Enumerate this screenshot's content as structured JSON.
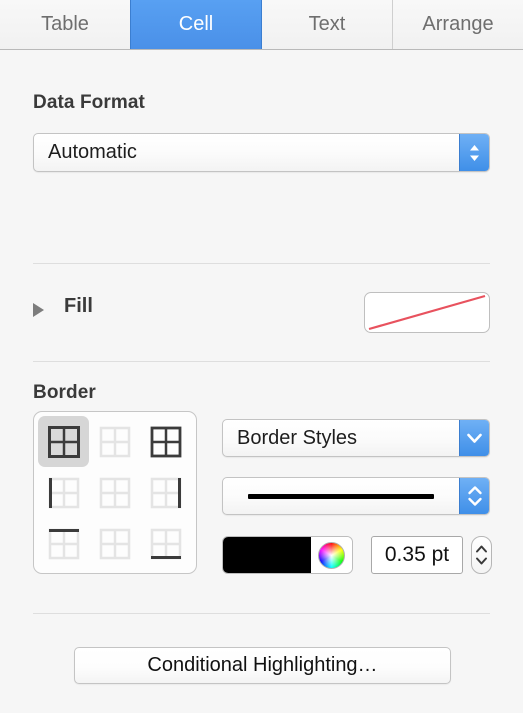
{
  "tabs": [
    {
      "label": "Table",
      "selected": false
    },
    {
      "label": "Cell",
      "selected": true
    },
    {
      "label": "Text",
      "selected": false
    },
    {
      "label": "Arrange",
      "selected": false
    }
  ],
  "data_format": {
    "title": "Data Format",
    "value": "Automatic"
  },
  "fill": {
    "label": "Fill",
    "expanded": false,
    "swatch": "none",
    "swatch_line_color": "#e8525e"
  },
  "border": {
    "title": "Border",
    "grid_options": [
      {
        "name": "all-borders",
        "selected": true
      },
      {
        "name": "no-borders",
        "selected": false
      },
      {
        "name": "outline-borders",
        "selected": false
      },
      {
        "name": "left-border",
        "selected": false
      },
      {
        "name": "inner-borders-none",
        "selected": false
      },
      {
        "name": "right-border",
        "selected": false
      },
      {
        "name": "top-border",
        "selected": false
      },
      {
        "name": "middle-borders-none",
        "selected": false
      },
      {
        "name": "bottom-border",
        "selected": false
      }
    ],
    "styles_label": "Border Styles",
    "line_style": "solid",
    "color": "#000000",
    "width": "0.35 pt"
  },
  "conditional_highlighting": {
    "label": "Conditional Highlighting…"
  },
  "colors": {
    "accent": "#4a90e8",
    "panel_background": "#f6f6f6",
    "divider": "#dedede",
    "text": "#1d1d1d",
    "muted_text": "#6e6e6e"
  }
}
